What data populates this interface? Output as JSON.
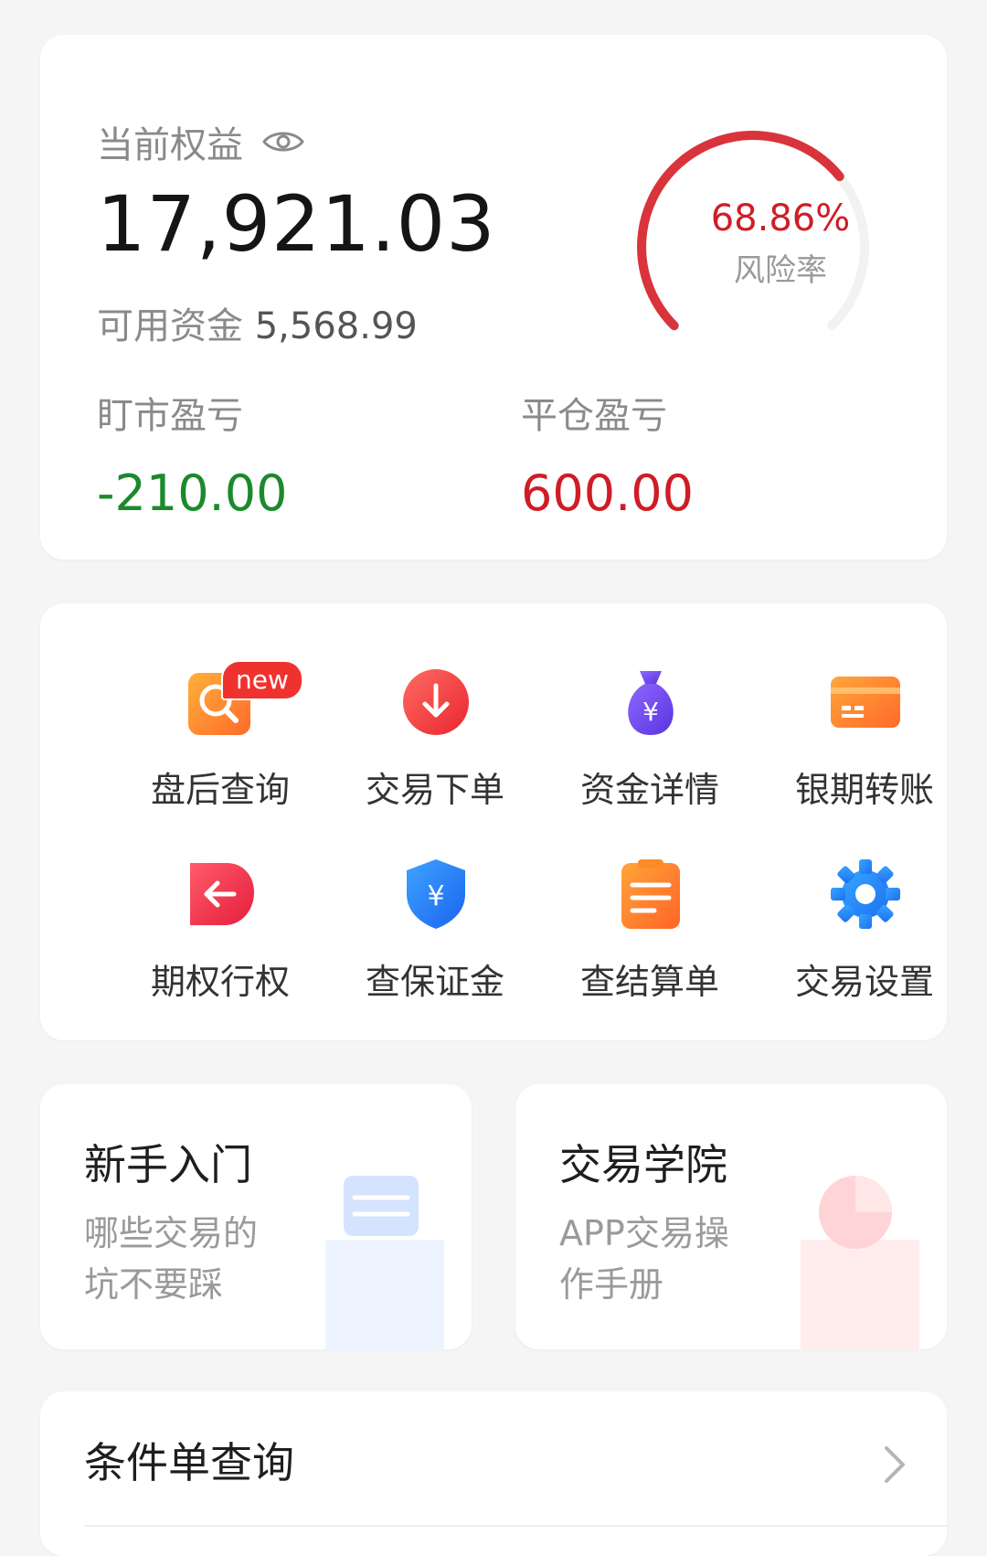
{
  "equity": {
    "label": "当前权益",
    "value": "17,921.03",
    "available_label": "可用资金",
    "available_value": "5,568.99",
    "risk_rate": 68.86,
    "risk_rate_text": "68.86%",
    "risk_label": "风险率",
    "mark_to_market_label": "盯市盈亏",
    "mark_to_market_value": "-210.00",
    "close_pl_label": "平仓盈亏",
    "close_pl_value": "600.00"
  },
  "grid": {
    "items": [
      {
        "label": "盘后查询",
        "icon": "search-doc-icon",
        "badge": "new"
      },
      {
        "label": "交易下单",
        "icon": "arrow-down-circle-icon"
      },
      {
        "label": "资金详情",
        "icon": "money-bag-icon"
      },
      {
        "label": "银期转账",
        "icon": "bank-card-icon"
      },
      {
        "label": "期权行权",
        "icon": "arrow-left-tag-icon"
      },
      {
        "label": "查保证金",
        "icon": "shield-yen-icon"
      },
      {
        "label": "查结算单",
        "icon": "clipboard-icon"
      },
      {
        "label": "交易设置",
        "icon": "gear-icon"
      }
    ]
  },
  "promos": [
    {
      "title": "新手入门",
      "lines": [
        "哪些交易的",
        "坑不要踩"
      ],
      "icon": "slider-box-icon"
    },
    {
      "title": "交易学院",
      "lines": [
        "APP交易操",
        "作手册"
      ],
      "icon": "pie-box-icon"
    }
  ],
  "conditional": {
    "title": "条件单查询"
  },
  "colors": {
    "loss": "#1b8a2d",
    "profit": "#cf1d26",
    "gauge_arc": "#d9343b",
    "gauge_track": "#f2f2f2"
  }
}
